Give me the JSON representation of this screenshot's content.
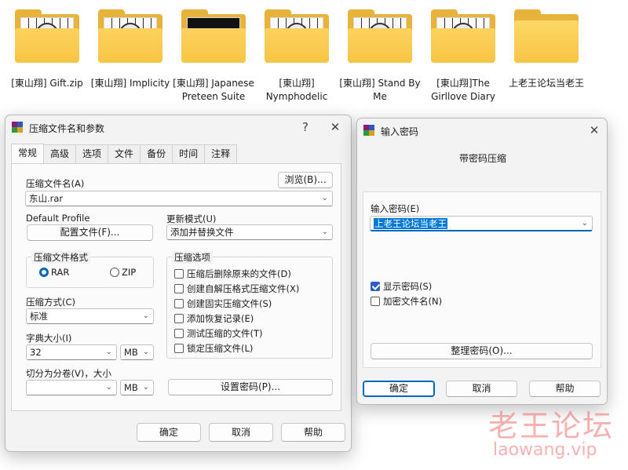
{
  "desktop": {
    "folders": [
      {
        "label": "[東山翔] Gift.zip",
        "thumb": "manga"
      },
      {
        "label": "[東山翔] Implicity",
        "thumb": "manga"
      },
      {
        "label": "[東山翔] Japanese Preteen Suite",
        "thumb": "dark"
      },
      {
        "label": "[東山翔] Nymphodelic",
        "thumb": "manga"
      },
      {
        "label": "[東山翔] Stand By Me",
        "thumb": "manga"
      },
      {
        "label": "[東山翔]The Girllove Diary",
        "thumb": "manga"
      },
      {
        "label": "上老王论坛当老王",
        "thumb": "none"
      }
    ]
  },
  "archive_dialog": {
    "title": "压缩文件名和参数",
    "help_glyph": "?",
    "close_glyph": "✕",
    "tabs": [
      "常规",
      "高级",
      "选项",
      "文件",
      "备份",
      "时间",
      "注释"
    ],
    "active_tab": "常规",
    "archive_name_label": "压缩文件名(A)",
    "browse_button": "浏览(B)...",
    "archive_name_value": "东山.rar",
    "default_profile_label": "Default Profile",
    "profiles_button": "配置文件(F)...",
    "update_mode_label": "更新模式(U)",
    "update_mode_value": "添加并替换文件",
    "format_group_title": "压缩文件格式",
    "format_rar": "RAR",
    "format_zip": "ZIP",
    "selected_format": "RAR",
    "options_group_title": "压缩选项",
    "options": [
      {
        "label": "压缩后删除原来的文件(D)",
        "checked": false
      },
      {
        "label": "创建自解压格式压缩文件(X)",
        "checked": false
      },
      {
        "label": "创建固实压缩文件(S)",
        "checked": false
      },
      {
        "label": "添加恢复记录(E)",
        "checked": false
      },
      {
        "label": "测试压缩的文件(T)",
        "checked": false
      },
      {
        "label": "锁定压缩文件(L)",
        "checked": false
      }
    ],
    "method_label": "压缩方式(C)",
    "method_value": "标准",
    "dictionary_label": "字典大小(I)",
    "dictionary_value": "32",
    "dictionary_unit": "MB",
    "split_label": "切分为分卷(V)，大小",
    "split_value": "",
    "split_unit": "MB",
    "set_password_button": "设置密码(P)...",
    "ok_button": "确定",
    "cancel_button": "取消",
    "help_button": "帮助"
  },
  "password_dialog": {
    "title": "输入密码",
    "close_glyph": "✕",
    "header": "带密码压缩",
    "password_label": "输入密码(E)",
    "password_value": "上老王论坛当老王",
    "show_password_label": "显示密码(S)",
    "show_password_checked": true,
    "encrypt_names_label": "加密文件名(N)",
    "encrypt_names_checked": false,
    "organize_button": "整理密码(O)...",
    "ok_button": "确定",
    "cancel_button": "取消",
    "help_button": "帮助"
  },
  "watermark": {
    "main": "老王论坛",
    "sub": "laowang.vip"
  },
  "colors": {
    "folder_yellow": "#f6c545",
    "accent_blue": "#0067c0",
    "selection_blue": "#2b5fc7",
    "watermark_red": "#eb4646"
  }
}
